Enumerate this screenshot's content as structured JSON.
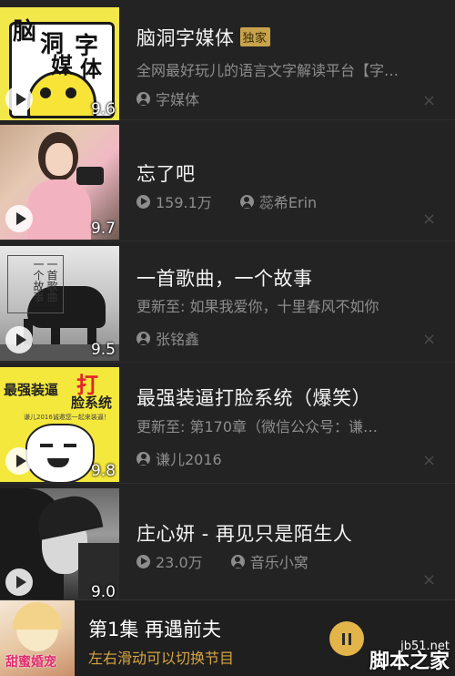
{
  "items": [
    {
      "title": "脑洞字媒体",
      "badge": "独家",
      "subtitle": "全网最好玩儿的语言文字解读平台【字…",
      "author": "字媒体",
      "score": "9.6",
      "cover_text": [
        "脑",
        "洞",
        "字",
        "媒",
        "体"
      ]
    },
    {
      "title": "忘了吧",
      "plays": "159.1万",
      "author": "蕊希Erin",
      "score": "9.7"
    },
    {
      "title": "一首歌曲，一个故事",
      "subtitle": "更新至: 如果我爱你，十里春风不如你",
      "author": "张铭鑫",
      "score": "9.5",
      "cover_text": "一首歌曲一个故事"
    },
    {
      "title": "最强装逼打脸系统（爆笑）",
      "subtitle": "更新至: 第170章（微信公众号：谦…",
      "author": "谦儿2016",
      "score": "9.8",
      "cover_text": [
        "最强装逼",
        "打",
        "脸系统"
      ],
      "cover_caption": "谦儿2016诚邀您一起来装逼！"
    },
    {
      "title": "庄心妍 - 再见只是陌生人",
      "plays": "23.0万",
      "author": "音乐小窝",
      "score": "9.0"
    }
  ],
  "player": {
    "title": "第1集 再遇前夫",
    "hint": "左右滑动可以切换节目",
    "cover_text": "甜蜜婚宠"
  },
  "watermark": {
    "line1": "jb51.net",
    "line2": "脚本之家"
  },
  "colors": {
    "background": "#232323",
    "accent": "#e3b44a",
    "hint": "#d7a545",
    "muted_text": "#8d8d8d"
  }
}
